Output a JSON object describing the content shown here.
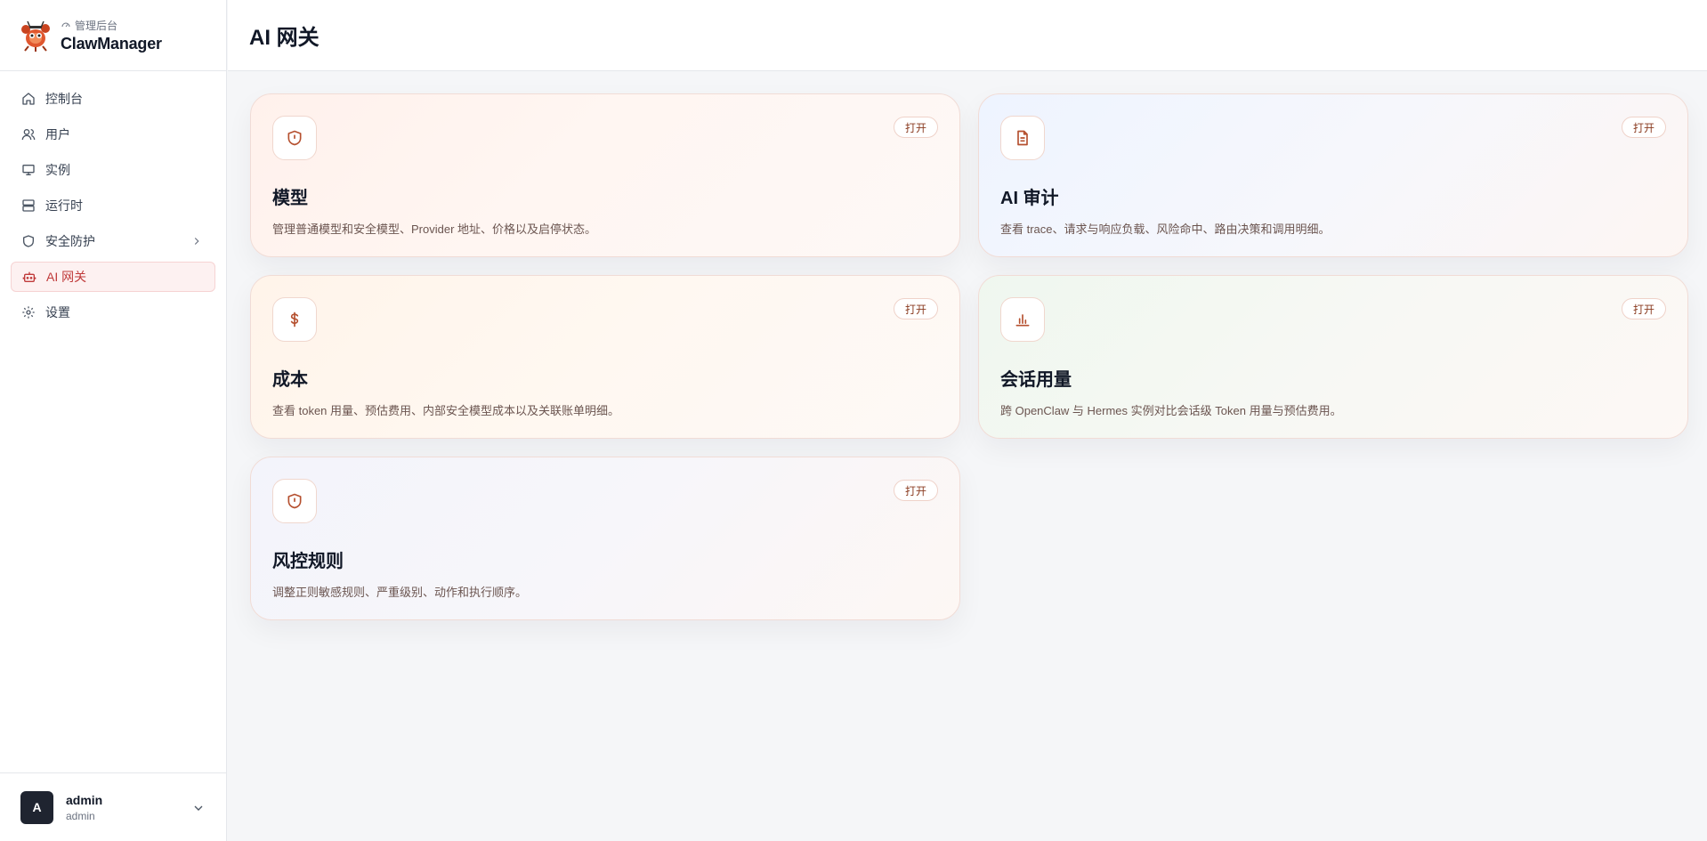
{
  "brand": {
    "subtitle": "管理后台",
    "title": "ClawManager"
  },
  "nav": {
    "items": [
      {
        "label": "控制台",
        "icon": "home-icon"
      },
      {
        "label": "用户",
        "icon": "users-icon"
      },
      {
        "label": "实例",
        "icon": "monitor-icon"
      },
      {
        "label": "运行时",
        "icon": "server-icon"
      },
      {
        "label": "安全防护",
        "icon": "shield-icon"
      },
      {
        "label": "AI 网关",
        "icon": "bot-icon",
        "active": true
      },
      {
        "label": "设置",
        "icon": "gear-icon"
      }
    ]
  },
  "user": {
    "initial": "A",
    "name": "admin",
    "role": "admin"
  },
  "header": {
    "title": "AI 网关"
  },
  "cards": [
    {
      "title": "模型",
      "desc": "管理普通模型和安全模型、Provider 地址、价格以及启停状态。",
      "button": "打开",
      "icon": "shield-alert-icon"
    },
    {
      "title": "AI 审计",
      "desc": "查看 trace、请求与响应负载、风险命中、路由决策和调用明细。",
      "button": "打开",
      "icon": "document-icon"
    },
    {
      "title": "成本",
      "desc": "查看 token 用量、预估费用、内部安全模型成本以及关联账单明细。",
      "button": "打开",
      "icon": "dollar-icon"
    },
    {
      "title": "会话用量",
      "desc": "跨 OpenClaw 与 Hermes 实例对比会话级 Token 用量与预估费用。",
      "button": "打开",
      "icon": "bar-chart-icon"
    },
    {
      "title": "风控规则",
      "desc": "调整正则敏感规则、严重级别、动作和执行顺序。",
      "button": "打开",
      "icon": "shield-alert-icon"
    }
  ],
  "colors": {
    "accent": "#c03a3a",
    "icon_stroke": "#b5502f",
    "avatar_bg": "#1f2430"
  }
}
